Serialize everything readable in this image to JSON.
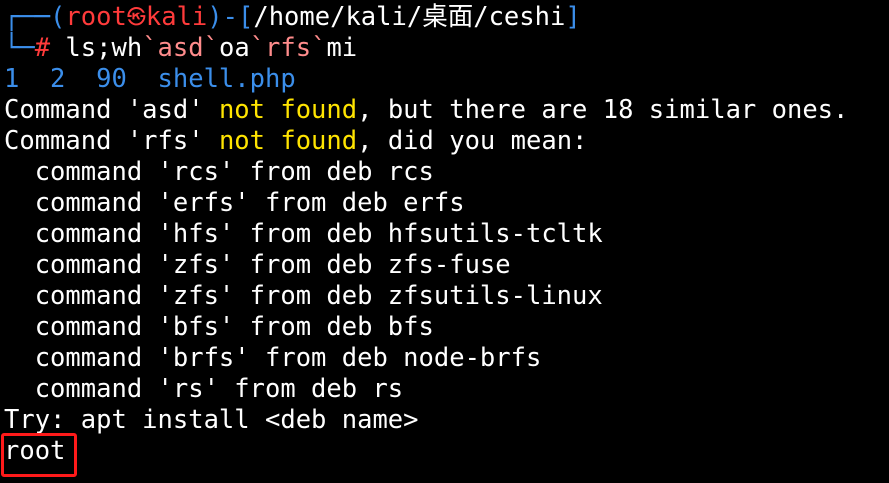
{
  "prompt": {
    "corner_top": "┌──(",
    "user": "root",
    "skull_icon": "㉿",
    "host": "kali",
    "path_open": ")-[",
    "path": "/home/kali/桌面/ceshi",
    "path_close": "]",
    "corner_bottom": "└─",
    "hash": "#",
    "cmd_part1": " ls;wh",
    "cmd_bt1": "`asd`",
    "cmd_part2": "oa",
    "cmd_bt2": "`rfs`",
    "cmd_part3": "mi"
  },
  "output": {
    "ls_line": "1  2  90  shell.php",
    "asd_pre": "Command 'asd' ",
    "asd_not_found": "not found",
    "asd_post": ", but there are 18 similar ones.",
    "rfs_pre": "Command 'rfs' ",
    "rfs_not_found": "not found",
    "rfs_post": ", did you mean:",
    "suggestions": [
      "  command 'rcs' from deb rcs",
      "  command 'erfs' from deb erfs",
      "  command 'hfs' from deb hfsutils-tcltk",
      "  command 'zfs' from deb zfs-fuse",
      "  command 'zfs' from deb zfsutils-linux",
      "  command 'bfs' from deb bfs",
      "  command 'brfs' from deb node-brfs",
      "  command 'rs' from deb rs"
    ],
    "try_line": "Try: apt install <deb name>",
    "result": "root"
  },
  "colors": {
    "background": "#000000",
    "prompt_frame": "#3b8eea",
    "user_host": "#ff3b3b",
    "highlight": "#ffe400",
    "text": "#ffffff",
    "annotation_box": "#ff1a1a"
  }
}
